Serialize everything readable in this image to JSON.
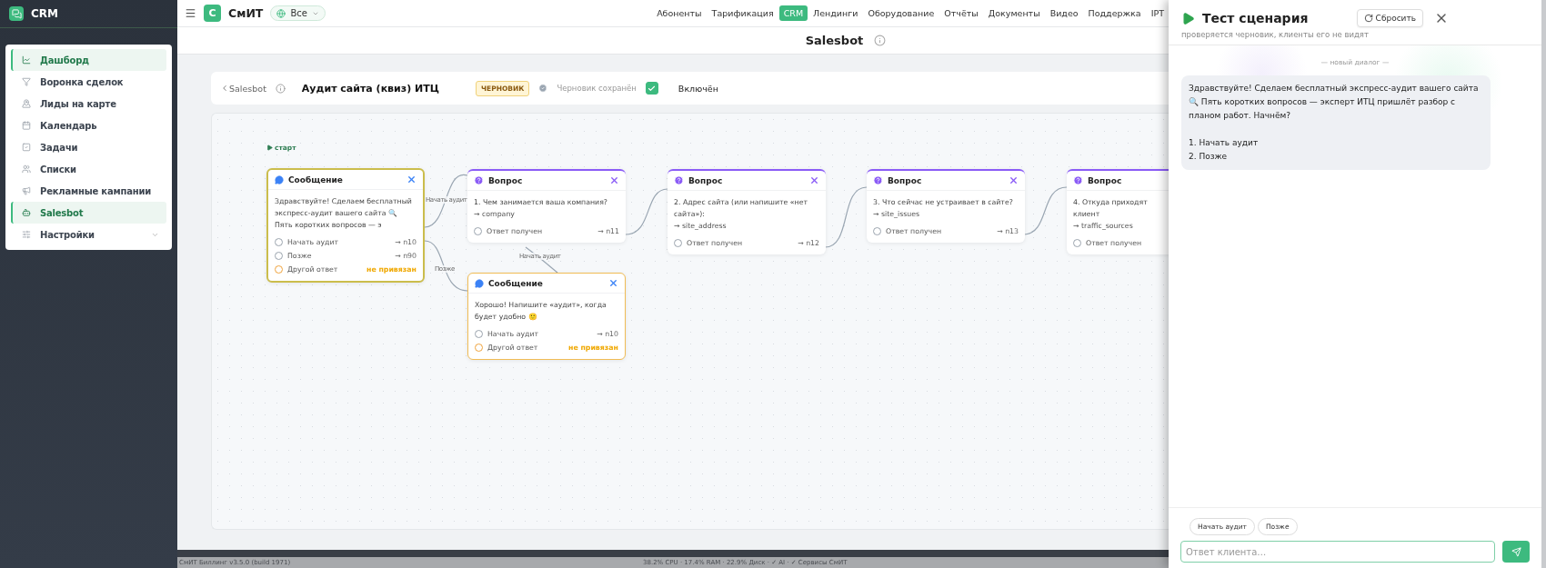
{
  "sidebar": {
    "brand": "CRM",
    "items": [
      {
        "label": "Дашборд",
        "selected": true
      },
      {
        "label": "Воронка сделок",
        "selected": false
      },
      {
        "label": "Лиды на карте",
        "selected": false
      },
      {
        "label": "Календарь",
        "selected": false
      },
      {
        "label": "Задачи",
        "selected": false
      },
      {
        "label": "Списки",
        "selected": false
      },
      {
        "label": "Рекламные кампании",
        "selected": false
      },
      {
        "label": "Salesbot",
        "selected": true
      },
      {
        "label": "Настройки",
        "selected": false,
        "expanded": false
      }
    ]
  },
  "topbar": {
    "logo": "С",
    "brand": "СмИТ",
    "scope": "Все",
    "nav": [
      {
        "label": "Абоненты",
        "selected": false
      },
      {
        "label": "Тарификация",
        "selected": false
      },
      {
        "label": "CRM",
        "selected": true
      },
      {
        "label": "Лендинги",
        "selected": false
      },
      {
        "label": "Оборудование",
        "selected": false
      },
      {
        "label": "Отчёты",
        "selected": false
      },
      {
        "label": "Документы",
        "selected": false
      },
      {
        "label": "Видео",
        "selected": false
      },
      {
        "label": "Поддержка",
        "selected": false
      },
      {
        "label": "IPT",
        "selected": false
      }
    ]
  },
  "page_title": "Salesbot",
  "scenario": {
    "back": "Salesbot",
    "title": "Аудит сайта (квиз) ИТЦ",
    "badge": "ЧЕРНОВИК",
    "saved": "Черновик сохранён",
    "enabled": true,
    "enabled_label": "Включён"
  },
  "canvas": {
    "start_label": "старт",
    "nodes": [
      {
        "kind": "message",
        "title": "Сообщение",
        "selected": true,
        "text": "Здравствуйте! Сделаем бесплатный экспресс-аудит вашего сайта 🔍 Пять коротких вопросов — э",
        "options": [
          {
            "label": "Начать аудит",
            "target": "→ n10",
            "kind": "choice"
          },
          {
            "label": "Позже",
            "target": "→ n90",
            "kind": "choice"
          },
          {
            "label": "Другой ответ",
            "target": "не привязан",
            "kind": "fallback"
          }
        ]
      },
      {
        "kind": "question",
        "title": "Вопрос",
        "selected": false,
        "text": "1. Чем занимается ваша компания?",
        "field": "→ company",
        "options": [
          {
            "label": "Ответ получен",
            "target": "→ n11",
            "kind": "choice"
          }
        ]
      },
      {
        "kind": "message",
        "title": "Сообщение",
        "selected": false,
        "text": "Хорошо! Напишите «аудит», когда будет удобно 🙂",
        "options": [
          {
            "label": "Начать аудит",
            "target": "→ n10",
            "kind": "choice"
          },
          {
            "label": "Другой ответ",
            "target": "не привязан",
            "kind": "fallback"
          }
        ]
      },
      {
        "kind": "question",
        "title": "Вопрос",
        "selected": false,
        "text": "2. Адрес сайта (или напишите «нет сайта»):",
        "field": "→ site_address",
        "options": [
          {
            "label": "Ответ получен",
            "target": "→ n12",
            "kind": "choice"
          }
        ]
      },
      {
        "kind": "question",
        "title": "Вопрос",
        "selected": false,
        "text": "3. Что сейчас не устраивает в сайте?",
        "field": "→ site_issues",
        "options": [
          {
            "label": "Ответ получен",
            "target": "→ n13",
            "kind": "choice"
          }
        ]
      },
      {
        "kind": "question",
        "title": "Вопрос",
        "selected": false,
        "text": "4. Откуда приходят клиент",
        "field": "→ traffic_sources",
        "options": [
          {
            "label": "Ответ получен",
            "kind": "choice"
          }
        ]
      }
    ],
    "edge_labels": [
      "Начать аудит",
      "Позже",
      "Начать аудит"
    ]
  },
  "status_bar": {
    "version": "СмИТ Биллинг v3.5.0 (build 1971)",
    "metrics": "38.2% CPU · 17.4% RAM · 22.9% Диск · ✓ AI · ✓ Сервисы СмИТ"
  },
  "test_panel": {
    "title": "Тест сценария",
    "reset": "Сбросить",
    "subtitle": "проверяется черновик, клиенты его не видят",
    "divider": "— новый диалог —",
    "messages": [
      {
        "text": "Здравствуйте! Сделаем бесплатный экспресс-аудит вашего сайта 🔍 Пять коротких вопросов — эксперт ИТЦ пришлёт разбор с планом работ. Начнём?\n\n1. Начать аудит\n2. Позже"
      }
    ],
    "quick_replies": [
      "Начать аудит",
      "Позже"
    ],
    "input": {
      "placeholder": "Ответ клиента…"
    }
  }
}
